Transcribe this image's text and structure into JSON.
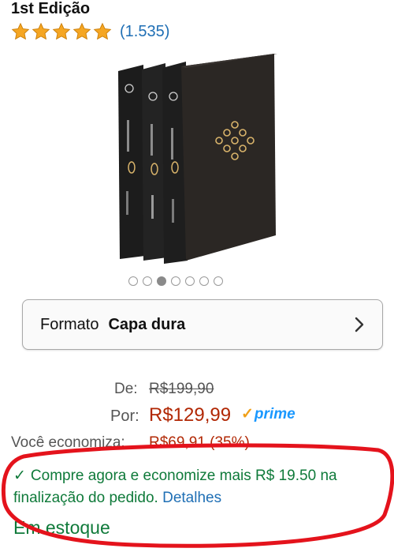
{
  "product": {
    "edition": "1st Edição",
    "rating": {
      "stars": 5,
      "count": "(1.535)"
    },
    "image_icon": "box-set-book-image",
    "carousel": {
      "total": 7,
      "active_index": 2
    },
    "format": {
      "label": "Formato",
      "value": "Capa dura"
    }
  },
  "pricing": {
    "de_label": "De:",
    "old_price": "R$199,90",
    "por_label": "Por:",
    "new_price": "R$129,99",
    "prime_label": "prime",
    "save_label": "Você economiza:",
    "save_value": "R$69,91 (35%)"
  },
  "promo": {
    "text": "Compre agora e economize mais R$ 19.50 na finalização do pedido.",
    "link": "Detalhes"
  },
  "stock": "Em estoque",
  "colors": {
    "price": "#b12704",
    "link": "#1f6fb5",
    "green": "#0f7a3a",
    "star": "#f5a623",
    "prime": "#1a98ff",
    "annotation": "#e4131c"
  }
}
